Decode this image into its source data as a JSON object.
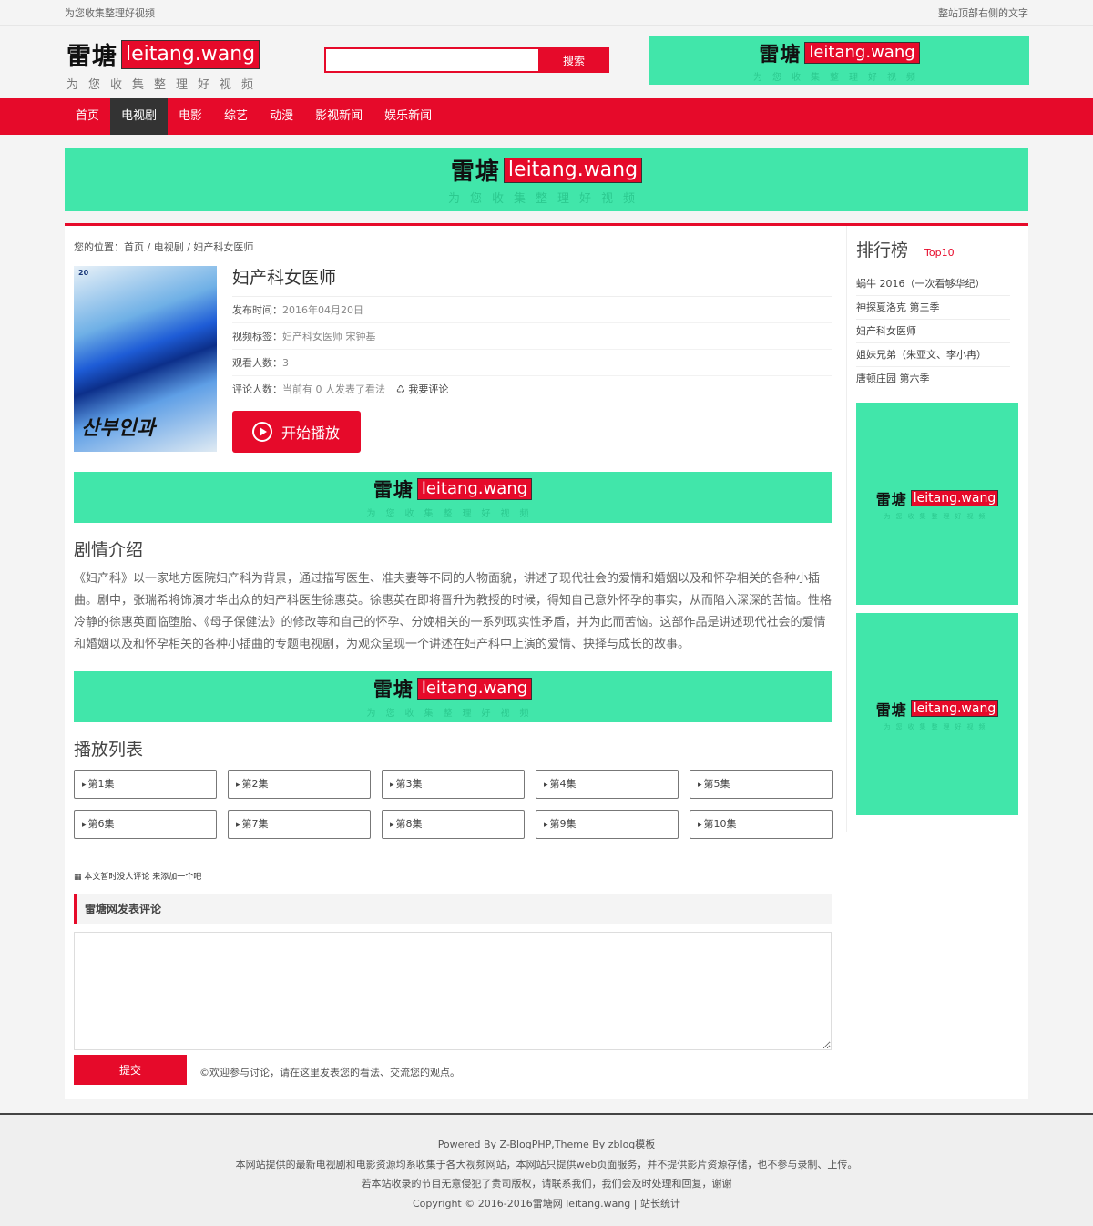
{
  "topbar": {
    "left_text": "为您收集整理好视频",
    "right_text": "整站顶部右侧的文字"
  },
  "brand": {
    "cn": "雷塘",
    "en": "leitang.wang",
    "tagline": "为您收集整理好视频"
  },
  "search": {
    "button": "搜索",
    "placeholder": ""
  },
  "nav": [
    {
      "label": "首页",
      "active": false
    },
    {
      "label": "电视剧",
      "active": true
    },
    {
      "label": "电影",
      "active": false
    },
    {
      "label": "综艺",
      "active": false
    },
    {
      "label": "动漫",
      "active": false
    },
    {
      "label": "影视新闻",
      "active": false
    },
    {
      "label": "娱乐新闻",
      "active": false
    }
  ],
  "breadcrumb": "您的位置：首页 / 电视剧 / 妇产科女医师",
  "video": {
    "poster_title": "산부인과",
    "poster_tag": "20",
    "title": "妇产科女医师",
    "publish_label": "发布时间：",
    "publish_value": "2016年04月20日",
    "tags_label": "视频标签：",
    "tags_value": "妇产科女医师  宋钟基",
    "views_label": "观看人数：",
    "views_value": "3",
    "comments_label": "评论人数：",
    "comments_value": "当前有 0 人发表了看法",
    "comment_link": "♺ 我要评论",
    "play_button": "开始播放"
  },
  "plot": {
    "title": "剧情介绍",
    "text": "《妇产科》以一家地方医院妇产科为背景，通过描写医生、准夫妻等不同的人物面貌，讲述了现代社会的爱情和婚姻以及和怀孕相关的各种小插曲。剧中，张瑞希将饰演才华出众的妇产科医生徐惠英。徐惠英在即将晋升为教授的时候，得知自己意外怀孕的事实，从而陷入深深的苦恼。性格冷静的徐惠英面临堕胎、《母子保健法》的修改等和自己的怀孕、分娩相关的一系列现实性矛盾，并为此而苦恼。这部作品是讲述现代社会的爱情和婚姻以及和怀孕相关的各种小插曲的专题电视剧，为观众呈现一个讲述在妇产科中上演的爱情、抉择与成长的故事。"
  },
  "playlist": {
    "title": "播放列表",
    "episodes": [
      "第1集",
      "第2集",
      "第3集",
      "第4集",
      "第5集",
      "第6集",
      "第7集",
      "第8集",
      "第9集",
      "第10集"
    ]
  },
  "comments": {
    "empty_text": "▦ 本文暂时没人评论 来添加一个吧",
    "form_title": "雷塘网发表评论",
    "submit": "提交",
    "tip": "©欢迎参与讨论，请在这里发表您的看法、交流您的观点。"
  },
  "ranking": {
    "title": "排行榜",
    "subtitle": "Top10",
    "items": [
      "蜗牛 2016（一次看够华纪）",
      "神探夏洛克 第三季",
      "妇产科女医师",
      "姐妹兄弟（朱亚文、李小冉）",
      "唐顿庄园 第六季"
    ]
  },
  "footer": {
    "line1": "Powered By Z-BlogPHP,Theme By zblog模板",
    "line2": "本网站提供的最新电视剧和电影资源均系收集于各大视频网站，本网站只提供web页面服务，并不提供影片资源存储，也不参与录制、上传。",
    "line3": "若本站收录的节目无意侵犯了贵司版权，请联系我们，我们会及时处理和回复，谢谢",
    "line4": "Copyright © 2016-2016雷塘网 leitang.wang | 站长统计"
  },
  "colors": {
    "accent": "#e60a2a",
    "ad_bg": "#41e6aa",
    "nav_active": "#333333"
  }
}
